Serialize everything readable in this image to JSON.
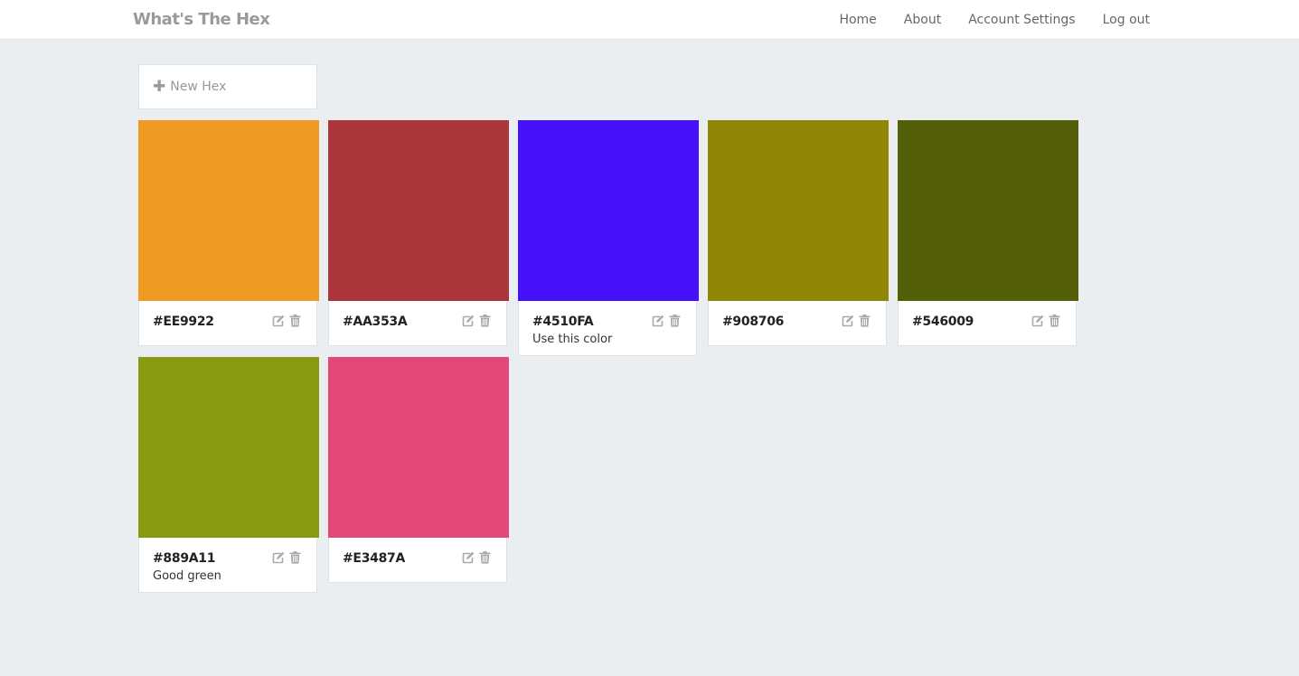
{
  "app": {
    "brand": "What's The Hex"
  },
  "nav": {
    "items": [
      {
        "label": "Home"
      },
      {
        "label": "About"
      },
      {
        "label": "Account Settings"
      },
      {
        "label": "Log out"
      }
    ]
  },
  "new_hex": {
    "label": "New Hex"
  },
  "colors": [
    {
      "hex": "#EE9922",
      "swatch": "#ee9922",
      "note": ""
    },
    {
      "hex": "#AA353A",
      "swatch": "#aa353a",
      "note": ""
    },
    {
      "hex": "#4510FA",
      "swatch": "#4510fa",
      "note": "Use this color"
    },
    {
      "hex": "#908706",
      "swatch": "#908706",
      "note": ""
    },
    {
      "hex": "#546009",
      "swatch": "#546009",
      "note": ""
    },
    {
      "hex": "#889A11",
      "swatch": "#889a11",
      "note": "Good green"
    },
    {
      "hex": "#E3487A",
      "swatch": "#e3487a",
      "note": ""
    }
  ],
  "icons": {
    "edit": "edit-icon",
    "delete": "trash-icon",
    "add": "plus-icon"
  }
}
